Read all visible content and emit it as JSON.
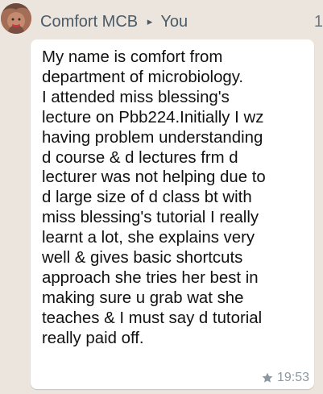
{
  "header": {
    "sender_name": "Comfort MCB",
    "arrow_glyph": "▸",
    "recipient": "You",
    "corner_number": "1"
  },
  "message": {
    "text": "My name is comfort from\ndepartment of microbiology.\nI attended miss blessing's\nlecture on Pbb224.Initially I wz\nhaving problem understanding\nd course & d lectures frm d\nlecturer was not helping due to\nd large size of d class bt with\nmiss blessing's tutorial I really\nlearnt a lot, she explains very\nwell & gives basic shortcuts\napproach she tries her best in\nmaking sure u grab wat she\nteaches & I must say d tutorial\nreally paid off.",
    "time": "19:53",
    "starred_icon": "star-icon"
  },
  "colors": {
    "chat_background": "#ece5dd",
    "bubble_background": "#ffffff",
    "header_text": "#4a5a66",
    "meta_text": "#8c979f"
  }
}
